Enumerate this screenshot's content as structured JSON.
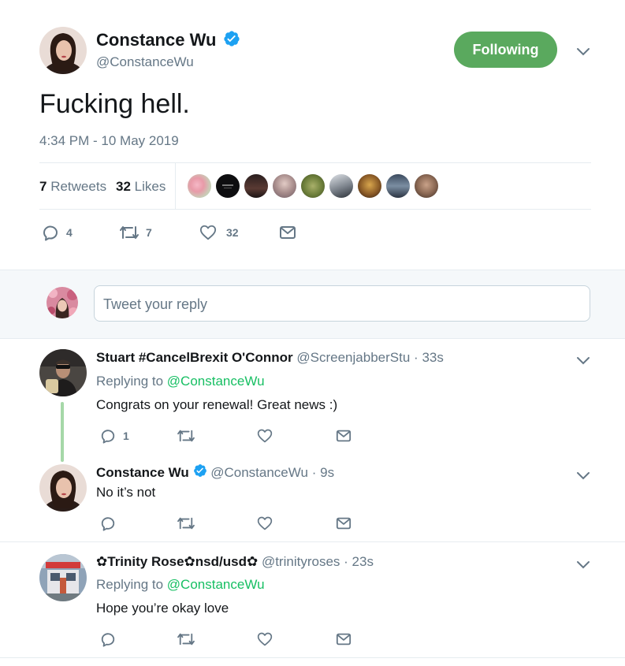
{
  "main_tweet": {
    "author_name": "Constance Wu",
    "author_handle": "@ConstanceWu",
    "follow_label": "Following",
    "text": "Fucking hell.",
    "timestamp": "4:34 PM - 10 May 2019",
    "retweets_count": "7",
    "retweets_label": "Retweets",
    "likes_count": "32",
    "likes_label": "Likes",
    "actions": {
      "replies": "4",
      "retweets": "7",
      "likes": "32"
    },
    "liker_avatars": 9
  },
  "reply_box": {
    "placeholder": "Tweet your reply"
  },
  "replies": [
    {
      "author_name": "Stuart #CancelBrexit O'Connor",
      "author_handle": "@ScreenjabberStu",
      "time": "33s",
      "replying_label": "Replying to",
      "replying_to": "@ConstanceWu",
      "text": "Congrats on your renewal! Great news :)",
      "actions": {
        "replies": "1",
        "retweets": "",
        "likes": ""
      }
    },
    {
      "author_name": "Constance Wu",
      "author_handle": "@ConstanceWu",
      "time": "9s",
      "text": "No it’s not",
      "actions": {
        "replies": "",
        "retweets": "",
        "likes": ""
      }
    },
    {
      "author_name": "✿Trinity Rose✿nsd/usd✿",
      "author_handle": "@trinityroses",
      "time": "23s",
      "replying_label": "Replying to",
      "replying_to": "@ConstanceWu",
      "text": "Hope you’re okay love",
      "actions": {
        "replies": "",
        "retweets": "",
        "likes": ""
      }
    }
  ],
  "colors": {
    "verified": "#1da1f2",
    "link": "#1b95e0",
    "follow_button": "#5aa95e",
    "thread_line": "#a6d8a8",
    "muted_text": "#657786"
  },
  "icons": [
    "verified-icon",
    "chevron-down-icon",
    "reply-icon",
    "retweet-icon",
    "like-icon",
    "message-icon"
  ]
}
